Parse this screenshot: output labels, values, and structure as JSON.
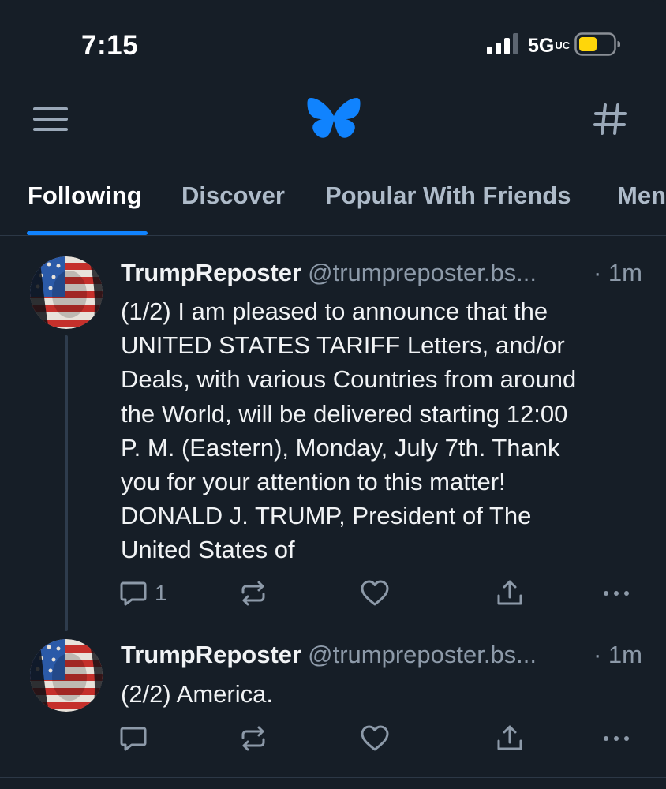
{
  "status_bar": {
    "time": "7:15",
    "network": "5G",
    "network_sup": "UC",
    "battery_color": "#ffd60a"
  },
  "nav": {
    "menu_icon": "hamburger-icon",
    "logo_icon": "butterfly-icon",
    "logo_color": "#1083fe",
    "feeds_icon": "hashtag-icon"
  },
  "tabs": [
    {
      "label": "Following",
      "active": true
    },
    {
      "label": "Discover",
      "active": false
    },
    {
      "label": "Popular With Friends",
      "active": false
    },
    {
      "label": "Men",
      "active": false
    }
  ],
  "posts": [
    {
      "author": "TrumpReposter",
      "handle": "@trumpreposter.bs...",
      "time": "· 1m",
      "text_lines": [
        "(1/2) I am pleased to announce that the",
        "UNITED STATES TARIFF Letters, and/or",
        "Deals, with various Countries from around",
        "the World, will be delivered starting 12:00",
        "P. M. (Eastern), Monday, July 7th. Thank",
        "you for your attention to this matter!",
        "DONALD J. TRUMP, President of The",
        "United States of"
      ],
      "reply_count": "1"
    },
    {
      "author": "TrumpReposter",
      "handle": "@trumpreposter.bs...",
      "time": "· 1m",
      "text_lines": [
        "(2/2) America."
      ],
      "reply_count": ""
    }
  ],
  "actions": {
    "reply_icon": "reply-icon",
    "repost_icon": "repost-icon",
    "like_icon": "heart-icon",
    "share_icon": "share-icon",
    "more_icon": "more-icon"
  }
}
